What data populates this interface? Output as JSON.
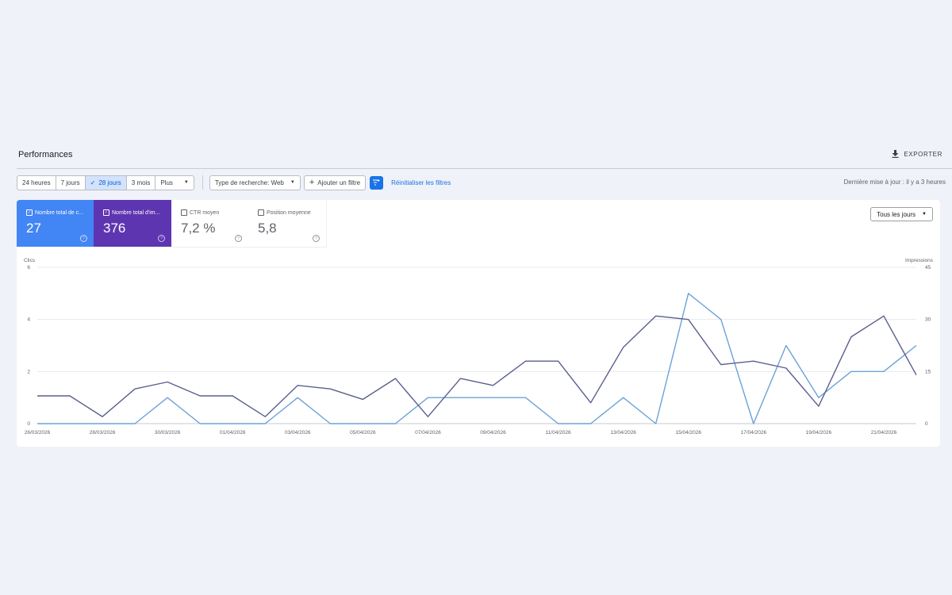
{
  "header": {
    "title": "Performances",
    "export_label": "EXPORTER"
  },
  "toolbar": {
    "ranges": [
      "24 heures",
      "7 jours",
      "28 jours",
      "3 mois"
    ],
    "active_range": "28 jours",
    "more_label": "Plus",
    "search_type_label": "Type de recherche: Web",
    "add_filter_label": "Ajouter un filtre",
    "reset_label": "Réinitialiser les filtres",
    "last_update": "Dernière mise à jour : il y a 3 heures"
  },
  "metrics": [
    {
      "label": "Nombre total de c...",
      "value": "27",
      "checked": true,
      "color": "#4285f4"
    },
    {
      "label": "Nombre total d'im...",
      "value": "376",
      "checked": true,
      "color": "#5e35b1"
    },
    {
      "label": "CTR moyen",
      "value": "7,2 %",
      "checked": false
    },
    {
      "label": "Position moyenne",
      "value": "5,8",
      "checked": false
    }
  ],
  "period_select": "Tous les jours",
  "chart_data": {
    "type": "line",
    "y_left_label": "Clics",
    "y_right_label": "Impressions",
    "y_left_ticks": [
      0,
      2,
      4,
      6
    ],
    "y_right_ticks": [
      0,
      15,
      30,
      45
    ],
    "ylim_left": [
      0,
      6
    ],
    "ylim_right": [
      0,
      45
    ],
    "x_ticks": [
      "26/03/2026",
      "28/03/2026",
      "30/03/2026",
      "01/04/2026",
      "03/04/2026",
      "05/04/2026",
      "07/04/2026",
      "09/04/2026",
      "11/04/2026",
      "13/04/2026",
      "15/04/2026",
      "17/04/2026",
      "19/04/2026",
      "21/04/2026"
    ],
    "x": [
      "26/03/2026",
      "27/03/2026",
      "28/03/2026",
      "29/03/2026",
      "30/03/2026",
      "31/03/2026",
      "01/04/2026",
      "02/04/2026",
      "03/04/2026",
      "04/04/2026",
      "05/04/2026",
      "06/04/2026",
      "07/04/2026",
      "08/04/2026",
      "09/04/2026",
      "10/04/2026",
      "11/04/2026",
      "12/04/2026",
      "13/04/2026",
      "14/04/2026",
      "15/04/2026",
      "16/04/2026",
      "17/04/2026",
      "18/04/2026",
      "19/04/2026",
      "20/04/2026",
      "21/04/2026",
      "22/04/2026"
    ],
    "series": [
      {
        "name": "Clics",
        "axis": "left",
        "color": "#6aa2d8",
        "values": [
          0,
          0,
          0,
          0,
          1,
          0,
          0,
          0,
          1,
          0,
          0,
          0,
          1,
          1,
          1,
          1,
          0,
          0,
          1,
          0,
          5,
          4,
          0,
          3,
          1,
          2,
          2,
          3
        ]
      },
      {
        "name": "Impressions",
        "axis": "right",
        "color": "#5a5f8e",
        "values": [
          8,
          8,
          2,
          10,
          12,
          8,
          8,
          2,
          11,
          10,
          7,
          13,
          2,
          13,
          11,
          18,
          18,
          6,
          22,
          31,
          30,
          17,
          18,
          16,
          5,
          25,
          31,
          14
        ]
      }
    ]
  }
}
